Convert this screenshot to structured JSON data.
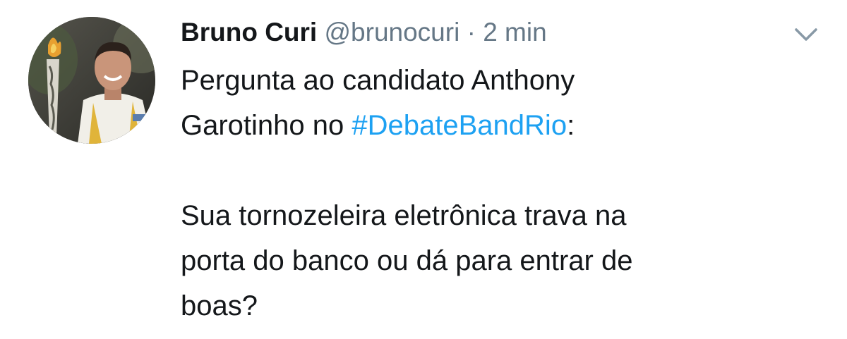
{
  "tweet": {
    "author": {
      "name": "Bruno Curi",
      "handle": "@brunocuri",
      "separator": "·",
      "time": "2 min"
    },
    "menu_icon": "chevron-down-icon",
    "text": {
      "line1": "Pergunta ao candidato Anthony",
      "line2_before": "Garotinho no ",
      "hashtag": "#DebateBandRio",
      "line2_after": ":",
      "line3": "Sua tornozeleira eletrônica trava na",
      "line4": "porta do banco ou dá para entrar de",
      "line5": "boas?"
    },
    "colors": {
      "hashtag": "#1da1f2",
      "secondary": "#657786",
      "text": "#14171a"
    }
  }
}
